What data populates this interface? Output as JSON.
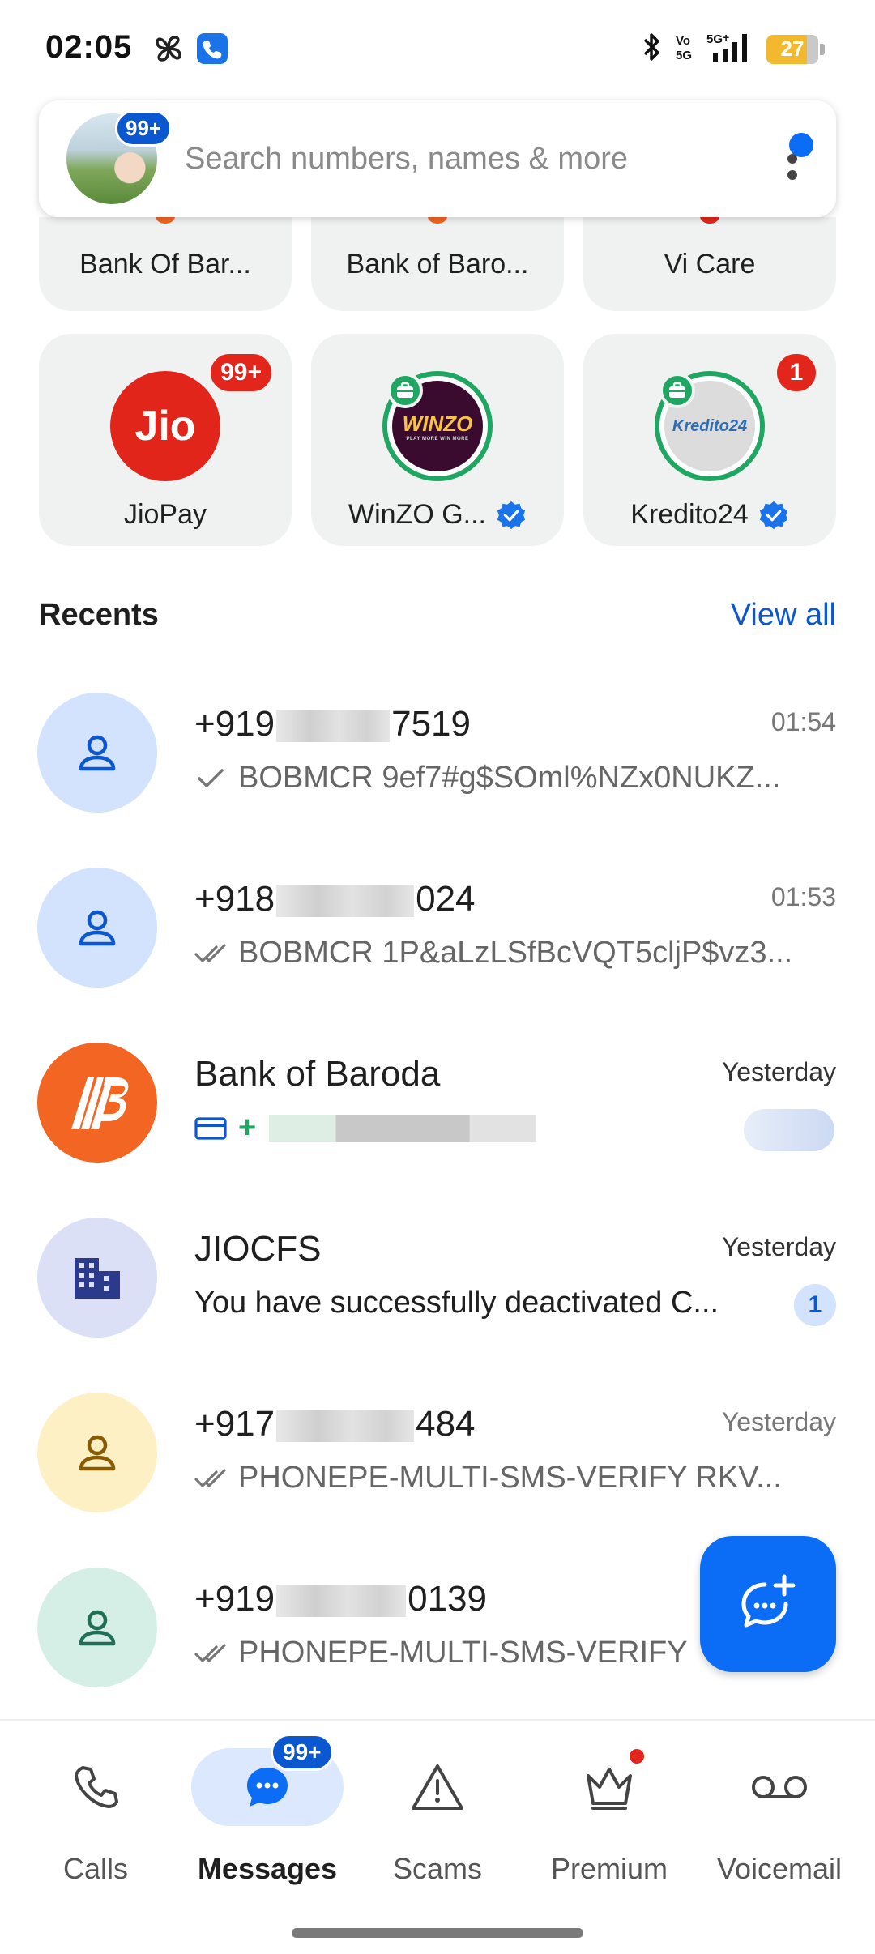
{
  "status_bar": {
    "time": "02:05",
    "left_icons": [
      "pinwheel-icon",
      "phone-app-icon"
    ],
    "right_icons": [
      "bluetooth-icon",
      "volte-icon",
      "signal-5g-icon"
    ],
    "battery": "27"
  },
  "search": {
    "placeholder": "Search numbers, names & more",
    "avatar_badge": "99+"
  },
  "top_cards_row1": [
    {
      "name": "Bank Of Bar...",
      "peek_color": "#f26522"
    },
    {
      "name": "Bank of Baro...",
      "peek_color": "#f26522"
    },
    {
      "name": "Vi Care",
      "peek_color": "#e3261c"
    }
  ],
  "top_cards_row2": [
    {
      "name": "JioPay",
      "badge": "99+",
      "verified": false,
      "logo": "jio-logo-icon",
      "logo_text": "Jio"
    },
    {
      "name": "WinZO G...",
      "badge": "",
      "verified": true,
      "logo": "winzo-logo-icon",
      "logo_text": "WINZO",
      "logo_subtext": "PLAY MORE WIN MORE"
    },
    {
      "name": "Kredito24",
      "badge": "1",
      "verified": true,
      "logo": "kredito24-logo-icon",
      "logo_text": "Kredito24"
    }
  ],
  "recents": {
    "title": "Recents",
    "view_all": "View all"
  },
  "conversations": [
    {
      "title_prefix": "+919",
      "title_suffix": "7519",
      "time": "01:54",
      "snippet": "BOBMCR 9ef7#g$SOml%NZx0NUKZ...",
      "status": "sent",
      "avatar_bg": "#d3e3fd",
      "avatar_fg": "#0b57d0",
      "avatar_icon": "person-icon"
    },
    {
      "title_prefix": "+918",
      "title_suffix": "024",
      "time": "01:53",
      "snippet": "BOBMCR 1P&aLzLSfBcVQT5cljP$vz3...",
      "status": "delivered",
      "avatar_bg": "#d3e3fd",
      "avatar_fg": "#0b57d0",
      "avatar_icon": "person-icon"
    },
    {
      "title": "Bank of Baroda",
      "time": "Yesterday",
      "snippet": "+",
      "status": "card",
      "avatar_bg": "#f26522",
      "avatar_fg": "#ffffff",
      "avatar_icon": "bank-of-baroda-logo-icon"
    },
    {
      "title": "JIOCFS",
      "time": "Yesterday",
      "snippet": "You have successfully deactivated C...",
      "status": "none",
      "unread": "1",
      "avatar_bg": "#dbe0f7",
      "avatar_fg": "#2c3a8c",
      "avatar_icon": "building-icon"
    },
    {
      "title_prefix": "+917",
      "title_suffix": "484",
      "time": "Yesterday",
      "snippet": "PHONEPE-MULTI-SMS-VERIFY RKV...",
      "status": "delivered",
      "avatar_bg": "#fdf0c4",
      "avatar_fg": "#8a5a00",
      "avatar_icon": "person-icon"
    },
    {
      "title_prefix": "+919",
      "title_suffix": "0139",
      "time": "",
      "snippet": "PHONEPE-MULTI-SMS-VERIFY",
      "status": "delivered",
      "avatar_bg": "#d6efe6",
      "avatar_fg": "#1f6e55",
      "avatar_icon": "person-icon"
    }
  ],
  "fab": {
    "icon": "new-message-icon"
  },
  "bottom_nav": [
    {
      "label": "Calls",
      "icon": "phone-icon",
      "active": false
    },
    {
      "label": "Messages",
      "icon": "chat-bubble-icon",
      "active": true,
      "badge": "99+"
    },
    {
      "label": "Scams",
      "icon": "warning-icon",
      "active": false
    },
    {
      "label": "Premium",
      "icon": "crown-icon",
      "active": false,
      "dot": true
    },
    {
      "label": "Voicemail",
      "icon": "voicemail-icon",
      "active": false
    }
  ],
  "colors": {
    "accent": "#0b57d0",
    "fab": "#0b6cf5",
    "badge_red": "#e3261c",
    "card_bg": "#f0f2f1",
    "verified_blue": "#1a73e8",
    "business_green": "#20a663"
  }
}
